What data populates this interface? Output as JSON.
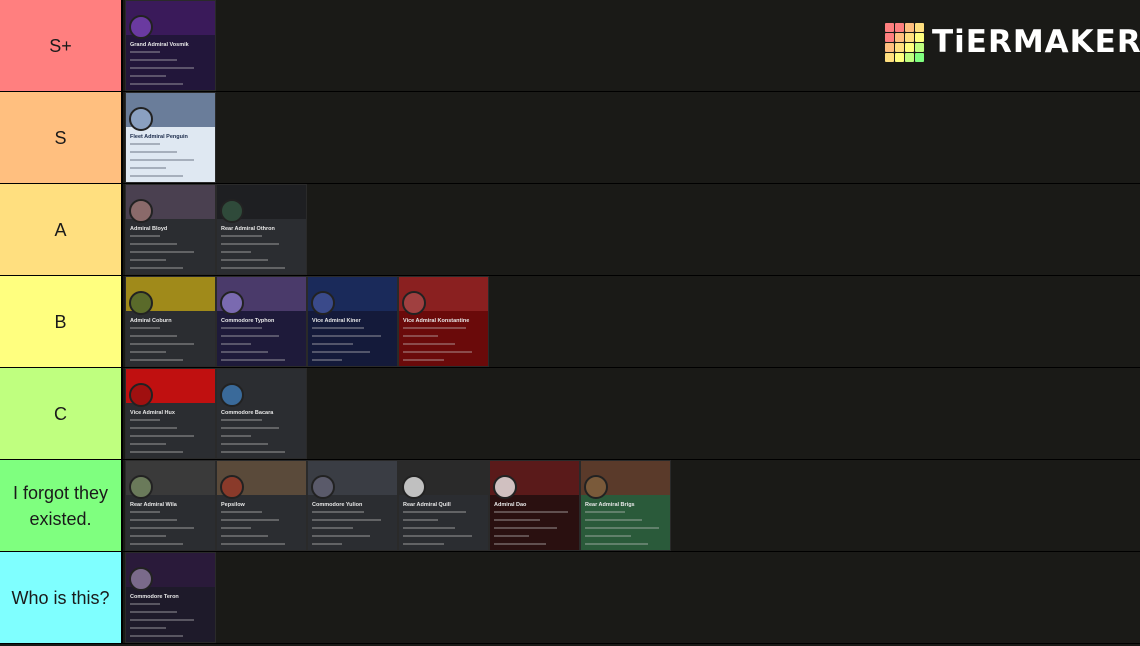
{
  "logo": {
    "text": "TiERMAKER",
    "grid_colors": [
      "#ff7f7f",
      "#ff7f7f",
      "#ffbf7f",
      "#ffdf7f",
      "#ff7f7f",
      "#ffbf7f",
      "#ffdf7f",
      "#ffff7f",
      "#ffbf7f",
      "#ffdf7f",
      "#ffff7f",
      "#bfff7f",
      "#ffdf7f",
      "#ffff7f",
      "#bfff7f",
      "#7fff7f"
    ]
  },
  "tiers": [
    {
      "label": "S+",
      "color": "#ff7f7f",
      "cards": [
        {
          "name": "Grand Admiral Vosmik",
          "banner": "#3a1a5a",
          "body": "#22163a",
          "avatar": "#6a3aa0"
        }
      ]
    },
    {
      "label": "S",
      "color": "#ffbf7f",
      "cards": [
        {
          "name": "Fleet Admiral Penguin",
          "banner": "#6a7d9a",
          "body": "#dfe8f2",
          "avatar": "#8aa0c0",
          "dark_text": true
        }
      ]
    },
    {
      "label": "A",
      "color": "#ffdf7f",
      "cards": [
        {
          "name": "Admiral Bloyd",
          "banner": "#4a4050",
          "body": "#2b2d31",
          "avatar": "#8a6a6a"
        },
        {
          "name": "Rear Admiral Othron",
          "banner": "#1e1f22",
          "body": "#2b2d31",
          "avatar": "#2f4a3a"
        }
      ]
    },
    {
      "label": "B",
      "color": "#ffff7f",
      "cards": [
        {
          "name": "Admiral Coburn",
          "banner": "#a08a1a",
          "body": "#2b2d31",
          "avatar": "#5a6a2a"
        },
        {
          "name": "Commodore Typhon",
          "banner": "#4a3a6a",
          "body": "#1e1a3a",
          "avatar": "#7a6ab0"
        },
        {
          "name": "Vice Admiral Kiner",
          "banner": "#1a2a5a",
          "body": "#141a3a",
          "avatar": "#3a4a8a"
        },
        {
          "name": "Vice Admiral Konstantine",
          "banner": "#8a2020",
          "body": "#6a0a0a",
          "avatar": "#a04040"
        }
      ]
    },
    {
      "label": "C",
      "color": "#bfff7f",
      "cards": [
        {
          "name": "Vice Admiral Hux",
          "banner": "#c01010",
          "body": "#2b2d31",
          "avatar": "#a01010"
        },
        {
          "name": "Commodore Bacara",
          "banner": "#2b2d31",
          "body": "#2b2d31",
          "avatar": "#3a6a9a"
        }
      ]
    },
    {
      "label": "I forgot they existed.",
      "color": "#7fff7f",
      "cards": [
        {
          "name": "Rear Admiral Wila",
          "banner": "#3a3a3a",
          "body": "#2b2d31",
          "avatar": "#6a7a5a"
        },
        {
          "name": "Pepsilow",
          "banner": "#5a4a3a",
          "body": "#2b2d31",
          "avatar": "#8a3a2a"
        },
        {
          "name": "Commodore Yulion",
          "banner": "#3a3d44",
          "body": "#2b2d31",
          "avatar": "#5a5a6a"
        },
        {
          "name": "Rear Admiral Quill",
          "banner": "#2a2a2a",
          "body": "#2b2d31",
          "avatar": "#c0c0c0"
        },
        {
          "name": "Admiral Dao",
          "banner": "#5a1a1a",
          "body": "#2a1010",
          "avatar": "#d0c0c0"
        },
        {
          "name": "Rear Admiral Brigs",
          "banner": "#5a3a2a",
          "body": "#2a5a3a",
          "avatar": "#7a5a3a"
        }
      ]
    },
    {
      "label": "Who is this?",
      "color": "#7fffff",
      "cards": [
        {
          "name": "Commodore Teron",
          "banner": "#2a1a3a",
          "body": "#1e1a2a",
          "avatar": "#7a6a8a"
        }
      ]
    }
  ]
}
